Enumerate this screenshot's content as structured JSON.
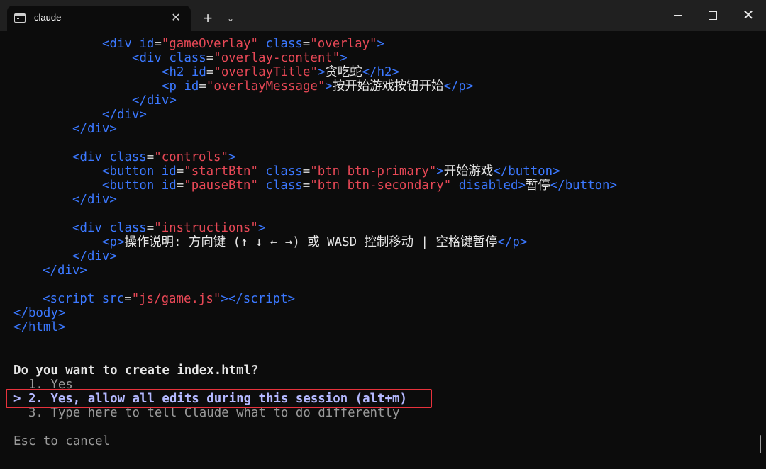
{
  "window": {
    "tab_title": "claude",
    "tab_close": "✕",
    "new_tab": "+",
    "dropdown": "⌄",
    "close": "✕"
  },
  "code": {
    "l1": [
      "<",
      "div",
      " ",
      "id",
      "=",
      "\"gameOverlay\"",
      " ",
      "class",
      "=",
      "\"overlay\"",
      ">"
    ],
    "l2": [
      "<",
      "div",
      " ",
      "class",
      "=",
      "\"overlay-content\"",
      ">"
    ],
    "l3": [
      "<",
      "h2",
      " ",
      "id",
      "=",
      "\"overlayTitle\"",
      ">",
      "贪吃蛇",
      "</",
      "h2",
      ">"
    ],
    "l4": [
      "<",
      "p",
      " ",
      "id",
      "=",
      "\"overlayMessage\"",
      ">",
      "按开始游戏按钮开始",
      "</",
      "p",
      ">"
    ],
    "l5": [
      "</",
      "div",
      ">"
    ],
    "l6": [
      "</",
      "div",
      ">"
    ],
    "l7": [
      "</",
      "div",
      ">"
    ],
    "l8": [
      "<",
      "div",
      " ",
      "class",
      "=",
      "\"controls\"",
      ">"
    ],
    "l9": [
      "<",
      "button",
      " ",
      "id",
      "=",
      "\"startBtn\"",
      " ",
      "class",
      "=",
      "\"btn btn-primary\"",
      ">",
      "开始游戏",
      "</",
      "button",
      ">"
    ],
    "l10": [
      "<",
      "button",
      " ",
      "id",
      "=",
      "\"pauseBtn\"",
      " ",
      "class",
      "=",
      "\"btn btn-secondary\"",
      " ",
      "disabled",
      ">",
      "暂停",
      "</",
      "button",
      ">"
    ],
    "l11": [
      "</",
      "div",
      ">"
    ],
    "l12": [
      "<",
      "div",
      " ",
      "class",
      "=",
      "\"instructions\"",
      ">"
    ],
    "l13": [
      "<",
      "p",
      ">",
      "操作说明: 方向键 (↑ ↓ ← →) 或 WASD 控制移动 | 空格键暂停",
      "</",
      "p",
      ">"
    ],
    "l14": [
      "</",
      "div",
      ">"
    ],
    "l15": [
      "</",
      "div",
      ">"
    ],
    "l16": [
      "<",
      "script",
      " ",
      "src",
      "=",
      "\"js/game.js\"",
      "></",
      "script",
      ">"
    ],
    "l17": [
      "</",
      "body",
      ">"
    ],
    "l18": [
      "</",
      "html",
      ">"
    ]
  },
  "prompt": {
    "question": "Do you want to create index.html?",
    "option1": "  1. Yes",
    "option2_marker": "> ",
    "option2": "2. Yes, allow all edits during this session ",
    "option2_shortcut": "(alt+m)",
    "option3": "  3. Type here to tell Claude what to do differently",
    "cancel": "Esc to cancel"
  },
  "colors": {
    "tag": "#3b78ff",
    "string": "#e74856",
    "highlight_box": "#e8323c"
  }
}
